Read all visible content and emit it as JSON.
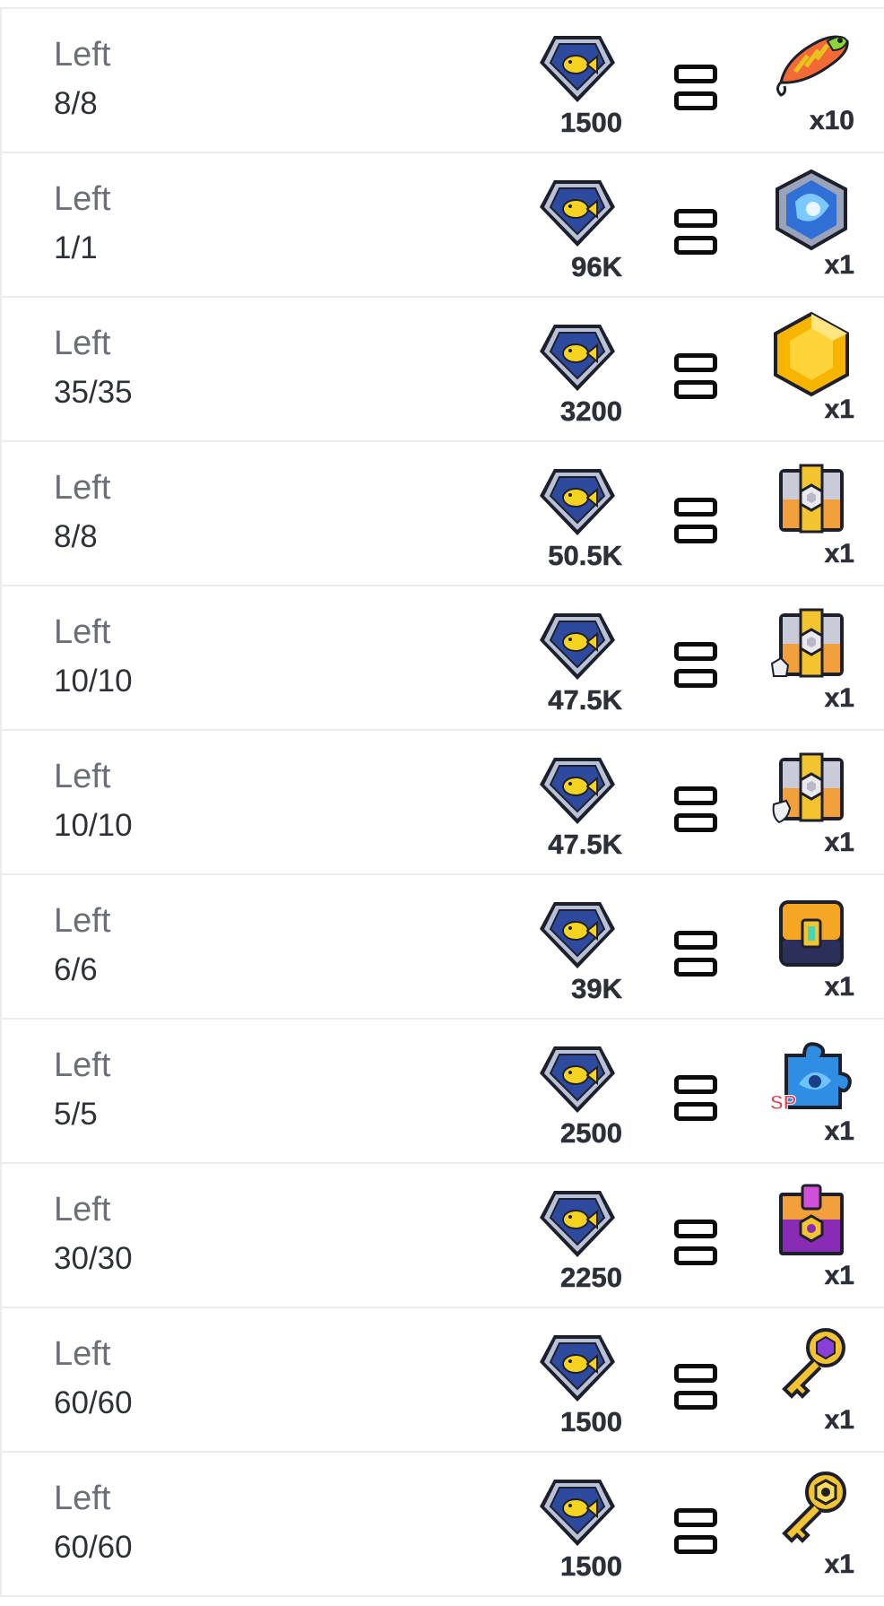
{
  "exchange_list": {
    "rows": [
      {
        "left_label": "Left",
        "left_count": "8/8",
        "cost_icon": "fish-coin-icon",
        "cost_amount": "1500",
        "separator": "equals-icon",
        "reward_icon": "fishing-lure-icon",
        "reward_qty": "x10"
      },
      {
        "left_label": "Left",
        "left_count": "1/1",
        "cost_icon": "fish-coin-icon",
        "cost_amount": "96K",
        "separator": "equals-icon",
        "reward_icon": "blue-cube-gem-icon",
        "reward_qty": "x1"
      },
      {
        "left_label": "Left",
        "left_count": "35/35",
        "cost_icon": "fish-coin-icon",
        "cost_amount": "3200",
        "separator": "equals-icon",
        "reward_icon": "gold-gem-icon",
        "reward_qty": "x1"
      },
      {
        "left_label": "Left",
        "left_count": "8/8",
        "cost_icon": "fish-coin-icon",
        "cost_amount": "50.5K",
        "separator": "equals-icon",
        "reward_icon": "gear-chest-icon",
        "reward_qty": "x1"
      },
      {
        "left_label": "Left",
        "left_count": "10/10",
        "cost_icon": "fish-coin-icon",
        "cost_amount": "47.5K",
        "separator": "equals-icon",
        "reward_icon": "gear-chest-glove-icon",
        "reward_qty": "x1"
      },
      {
        "left_label": "Left",
        "left_count": "10/10",
        "cost_icon": "fish-coin-icon",
        "cost_amount": "47.5K",
        "separator": "equals-icon",
        "reward_icon": "gear-chest-shield-icon",
        "reward_qty": "x1"
      },
      {
        "left_label": "Left",
        "left_count": "6/6",
        "cost_icon": "fish-coin-icon",
        "cost_amount": "39K",
        "separator": "equals-icon",
        "reward_icon": "orange-crate-icon",
        "reward_qty": "x1"
      },
      {
        "left_label": "Left",
        "left_count": "5/5",
        "cost_icon": "fish-coin-icon",
        "cost_amount": "2500",
        "separator": "equals-icon",
        "reward_icon": "sp-puzzle-piece-icon",
        "reward_qty": "x1",
        "reward_badge": "SP"
      },
      {
        "left_label": "Left",
        "left_count": "30/30",
        "cost_icon": "fish-coin-icon",
        "cost_amount": "2250",
        "separator": "equals-icon",
        "reward_icon": "purple-chest-icon",
        "reward_qty": "x1"
      },
      {
        "left_label": "Left",
        "left_count": "60/60",
        "cost_icon": "fish-coin-icon",
        "cost_amount": "1500",
        "separator": "equals-icon",
        "reward_icon": "purple-gem-key-icon",
        "reward_qty": "x1"
      },
      {
        "left_label": "Left",
        "left_count": "60/60",
        "cost_icon": "fish-coin-icon",
        "cost_amount": "1500",
        "separator": "equals-icon",
        "reward_icon": "gold-gear-key-icon",
        "reward_qty": "x1"
      }
    ]
  },
  "colors": {
    "coin_blue": "#2e4a9e",
    "coin_border": "#a9b4cc",
    "fish_yellow": "#f7d321",
    "text_dark": "#2d3039",
    "text_gray": "#6c6f77",
    "divider": "#ececec"
  }
}
